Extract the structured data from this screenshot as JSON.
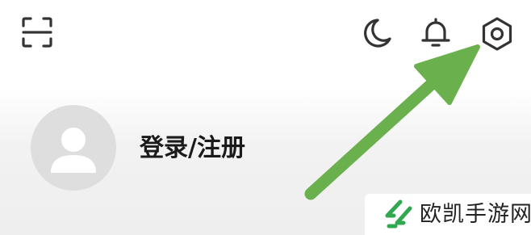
{
  "header": {
    "icons": {
      "scan": "scan-icon",
      "night_mode": "moon-icon",
      "notifications": "bell-icon",
      "settings": "gear-icon"
    }
  },
  "profile": {
    "avatar": "default-user-avatar",
    "login_label": "登录/注册"
  },
  "annotation": {
    "arrow_color": "#6ab04c",
    "points_to": "settings"
  },
  "watermark": {
    "text": "欧凯手游网",
    "logo_color": "#2fa84f"
  },
  "colors": {
    "icon": "#333333",
    "avatar_bg": "#dedede",
    "avatar_fg": "#ffffff"
  }
}
